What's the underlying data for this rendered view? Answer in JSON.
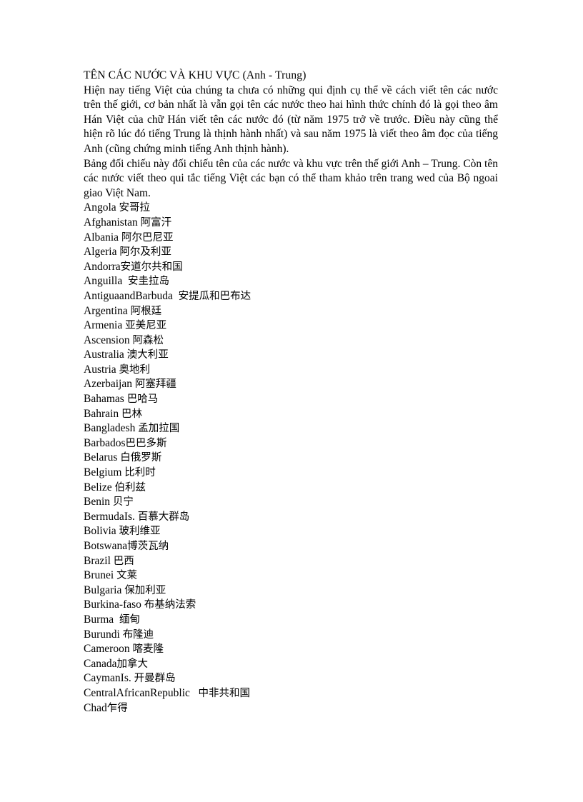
{
  "document": {
    "title": "TÊN CÁC NƯỚC VÀ KHU VỰC (Anh - Trung)",
    "paragraphs": [
      "Hiện nay tiếng Việt của chúng ta chưa có những qui định cụ thể về cách viết tên các nước trên thế giới,  cơ bản nhất là vẫn gọi tên các nước theo hai hình thức chính đó là gọi theo âm Hán Việt của chữ Hán viết tên các nước đó (từ năm 1975 trở về trước. Điều này cũng thể hiện rõ lúc đó tiếng Trung là thịnh hành nhất) và sau năm 1975 là viết theo âm đọc của tiếng Anh (cũng chứng minh tiếng Anh thịnh hành).",
      "Bảng đối chiếu này đối chiếu tên của các nước và khu vực trên thế giới Anh – Trung. Còn tên các nước viết theo qui tắc tiếng Việt các bạn có thể tham khảo trên trang wed của Bộ ngoai giao Việt Nam."
    ],
    "entries": [
      {
        "en": "Angola ",
        "zh": "安哥拉"
      },
      {
        "en": "Afghanistan ",
        "zh": "阿富汗"
      },
      {
        "en": "Albania ",
        "zh": "阿尔巴尼亚"
      },
      {
        "en": "Algeria ",
        "zh": "阿尔及利亚"
      },
      {
        "en": "Andorra",
        "zh": "安道尔共和国"
      },
      {
        "en": "Anguilla  ",
        "zh": "安圭拉岛"
      },
      {
        "en": "AntiguaandBarbuda  ",
        "zh": "安提瓜和巴布达"
      },
      {
        "en": "Argentina ",
        "zh": "阿根廷"
      },
      {
        "en": "Armenia ",
        "zh": "亚美尼亚"
      },
      {
        "en": "Ascension ",
        "zh": "阿森松"
      },
      {
        "en": "Australia ",
        "zh": "澳大利亚"
      },
      {
        "en": "Austria ",
        "zh": "奥地利"
      },
      {
        "en": "Azerbaijan ",
        "zh": "阿塞拜疆"
      },
      {
        "en": "Bahamas ",
        "zh": "巴哈马"
      },
      {
        "en": "Bahrain ",
        "zh": "巴林"
      },
      {
        "en": "Bangladesh ",
        "zh": "孟加拉国"
      },
      {
        "en": "Barbados",
        "zh": "巴巴多斯"
      },
      {
        "en": "Belarus ",
        "zh": "白俄罗斯"
      },
      {
        "en": "Belgium ",
        "zh": "比利时"
      },
      {
        "en": "Belize ",
        "zh": "伯利兹"
      },
      {
        "en": "Benin ",
        "zh": "贝宁"
      },
      {
        "en": "BermudaIs. ",
        "zh": "百慕大群岛"
      },
      {
        "en": "Bolivia ",
        "zh": "玻利维亚"
      },
      {
        "en": "Botswana",
        "zh": "博茨瓦纳"
      },
      {
        "en": "Brazil ",
        "zh": "巴西"
      },
      {
        "en": "Brunei ",
        "zh": "文莱"
      },
      {
        "en": "Bulgaria ",
        "zh": "保加利亚"
      },
      {
        "en": "Burkina-faso ",
        "zh": "布基纳法索"
      },
      {
        "en": "Burma  ",
        "zh": "缅甸"
      },
      {
        "en": "Burundi ",
        "zh": "布隆迪"
      },
      {
        "en": "Cameroon ",
        "zh": "喀麦隆"
      },
      {
        "en": "Canada",
        "zh": "加拿大"
      },
      {
        "en": "CaymanIs. ",
        "zh": "开曼群岛"
      },
      {
        "en": "CentralAfricanRepublic   ",
        "zh": "中非共和国"
      },
      {
        "en": "Chad",
        "zh": "乍得"
      }
    ]
  }
}
